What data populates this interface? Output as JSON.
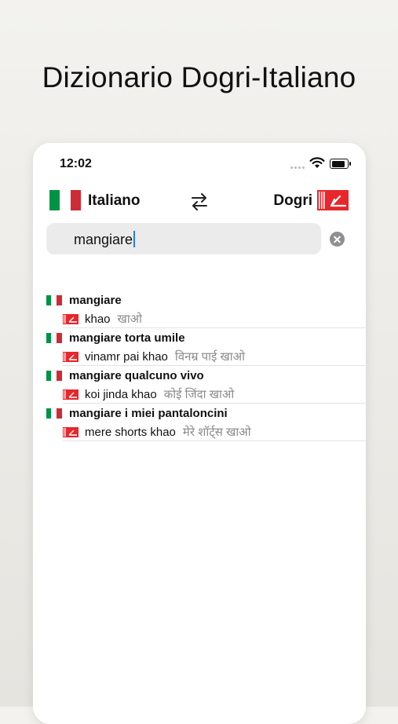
{
  "headline": "Dizionario Dogri-Italiano",
  "status_bar": {
    "time": "12:02"
  },
  "lang_bar": {
    "source_lang": "Italiano",
    "target_lang": "Dogri"
  },
  "search": {
    "value": "mangiare"
  },
  "colors": {
    "italy_green": "#009246",
    "italy_white": "#ffffff",
    "italy_red": "#ce2b37",
    "dogri_red": "#e8262b"
  },
  "results": [
    {
      "term": "mangiare",
      "translit": "khao",
      "native": "खाओ"
    },
    {
      "term": "mangiare torta umile",
      "translit": "vinamr pai khao",
      "native": "विनम्र पाई खाओ"
    },
    {
      "term": "mangiare qualcuno vivo",
      "translit": "koi jinda khao",
      "native": "कोई जिंदा खाओ"
    },
    {
      "term": "mangiare i miei pantaloncini",
      "translit": "mere shorts khao",
      "native": "मेरे शॉर्ट्स खाओ"
    }
  ]
}
